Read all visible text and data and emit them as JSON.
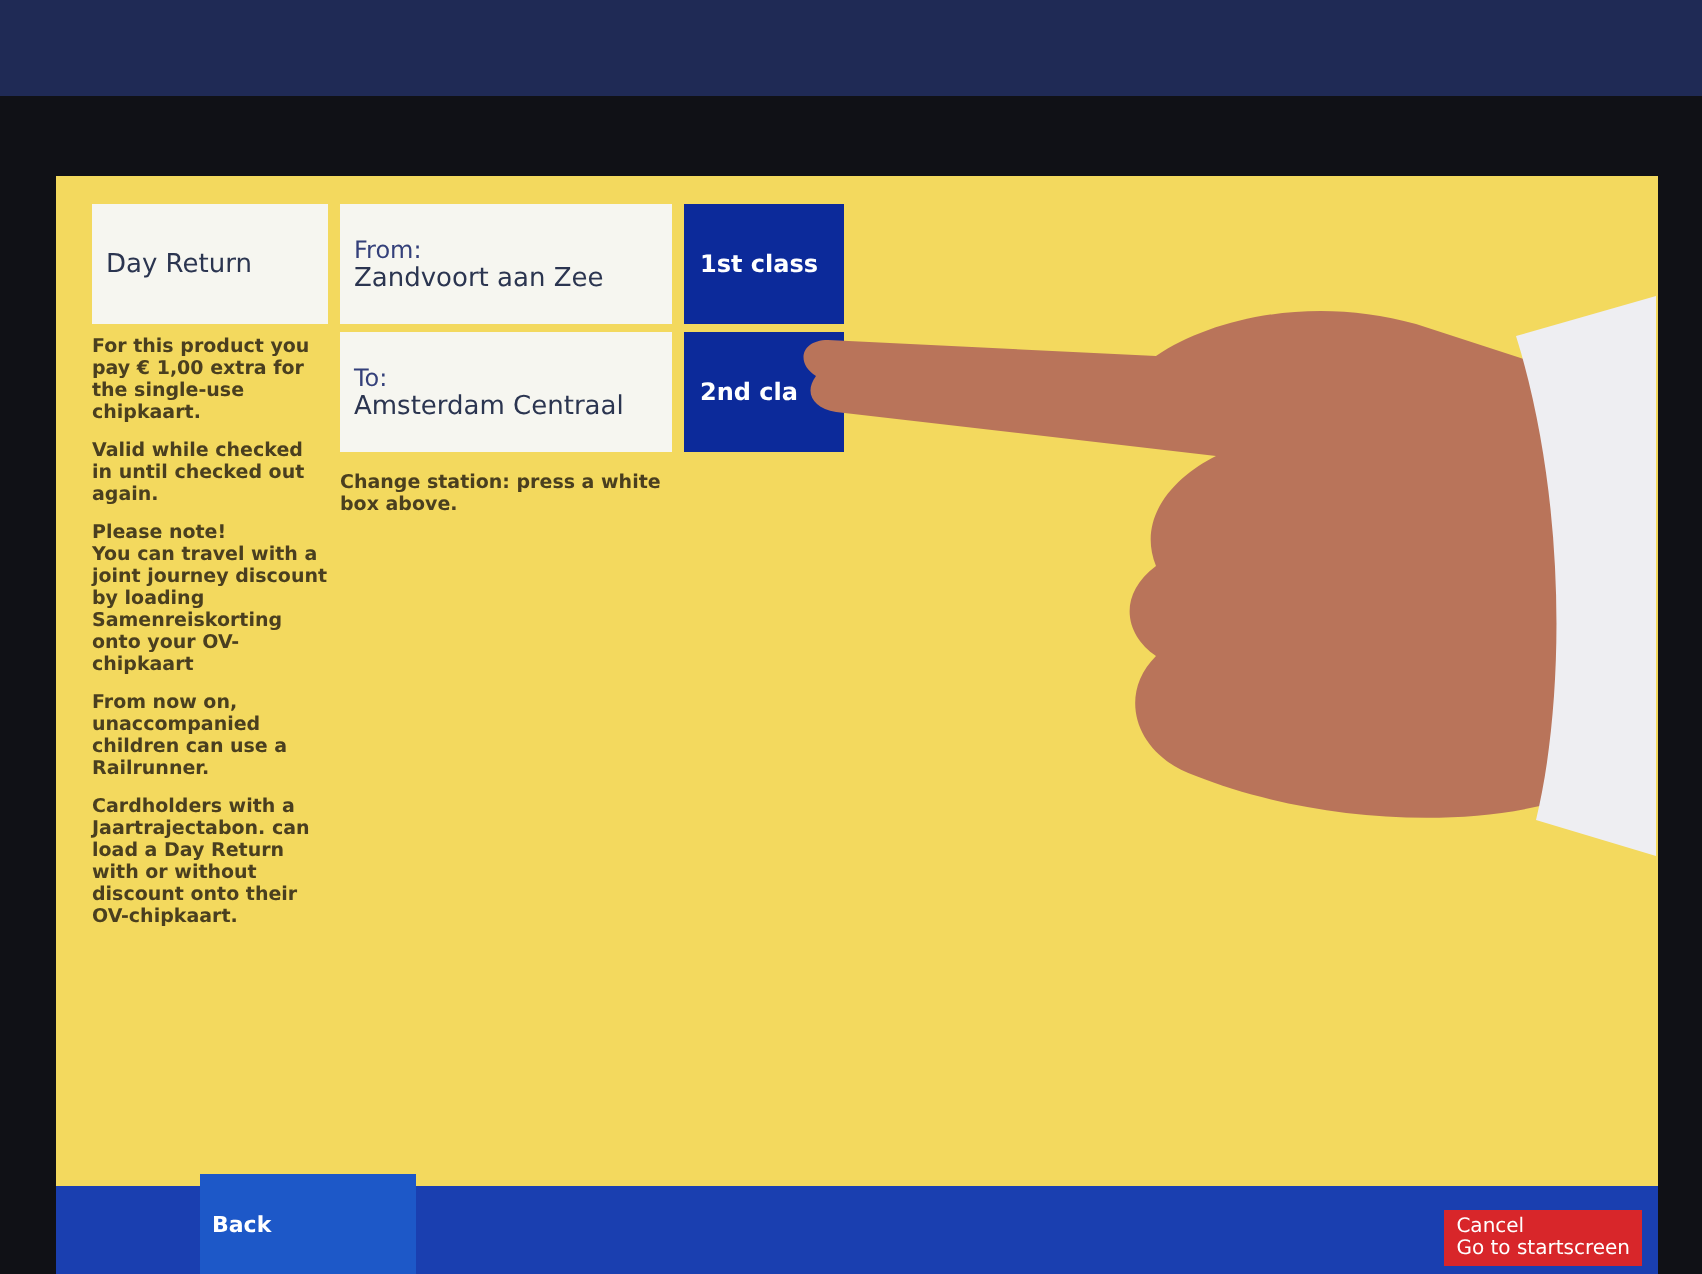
{
  "product": "Day Return",
  "from": {
    "label": "From:",
    "station": "Zandvoort aan Zee"
  },
  "to": {
    "label": "To:",
    "station": "Amsterdam Centraal"
  },
  "classes": [
    {
      "label": "1st class"
    },
    {
      "label": "2nd cla"
    }
  ],
  "notes": [
    "For this product you pay € 1,00 extra for the single-use chipkaart.",
    "Valid while checked in until checked out again.",
    "Please note!\nYou can travel with a joint journey discount by loading Samenreiskorting onto your OV-chipkaart",
    "From now on, unaccompanied children can use a Railrunner.",
    "Cardholders with a Jaartrajectabon. can load a Day Return with or without discount onto their OV-chipkaart."
  ],
  "station_hint": "Change station: press a white box above.",
  "back_button": "Back",
  "cancel_button": {
    "line_1": "Cancel",
    "line_2": "Go to startscreen"
  }
}
